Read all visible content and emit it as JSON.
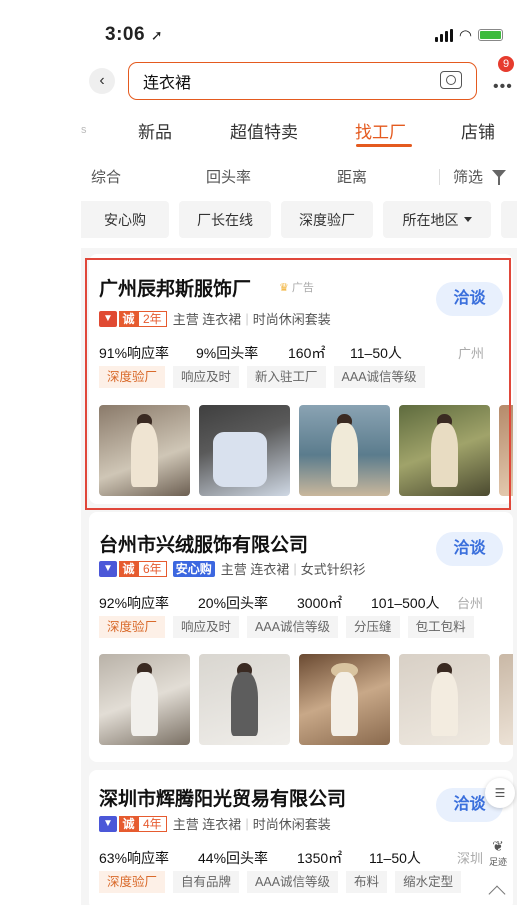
{
  "status_bar": {
    "time": "3:06",
    "location_icon": "location-arrow-icon"
  },
  "search": {
    "back_icon": "chevron-left-icon",
    "query": "连衣裙",
    "camera_icon": "camera-icon",
    "more_icon": "more-dots-icon",
    "badge_count": "9"
  },
  "tabs": [
    {
      "label": "新品",
      "active": false
    },
    {
      "label": "超值特卖",
      "active": false
    },
    {
      "label": "找工厂",
      "active": true
    },
    {
      "label": "店铺",
      "active": false
    }
  ],
  "tab_partial_left": "s",
  "sort_bar": {
    "items": [
      "综合",
      "回头率",
      "距离"
    ],
    "filter_label": "筛选",
    "filter_icon": "funnel-icon"
  },
  "chips": {
    "items": [
      "安心购",
      "厂长在线",
      "深度验厂"
    ],
    "region_label": "所在地区"
  },
  "colors": {
    "accent": "#e45a1f",
    "chat_bg": "#e8f0fd",
    "chat_text": "#3a6fdc",
    "highlight_border": "#e0473a"
  },
  "cards": [
    {
      "name": "广州辰邦斯服饰厂",
      "ad_label": "广告",
      "years": "2年",
      "cheng": "诚",
      "shield": "▼",
      "main_business": "主营 连衣裙",
      "categories": "时尚休闲套装",
      "chat": "洽谈",
      "stats": {
        "response": "91%响应率",
        "repeat": "9%回头率",
        "area": "160㎡",
        "staff": "11–50人",
        "city": "广州"
      },
      "tags": [
        {
          "text": "深度验厂",
          "style": "orange"
        },
        {
          "text": "响应及时",
          "style": "gray"
        },
        {
          "text": "新入驻工厂",
          "style": "gray"
        },
        {
          "text": "AAA诚信等级",
          "style": "gray"
        }
      ],
      "thumbs": [
        "dress-photo-cream",
        "dress-photo-blue-floral",
        "dress-photo-beach",
        "dress-photo-plaid"
      ]
    },
    {
      "name": "台州市兴绒服饰有限公司",
      "years": "6年",
      "cheng": "诚",
      "shield": "▼",
      "anxin": "安心购",
      "main_business": "主营 连衣裙",
      "categories": "女式针织衫",
      "chat": "洽谈",
      "stats": {
        "response": "92%响应率",
        "repeat": "20%回头率",
        "area": "3000㎡",
        "staff": "101–500人",
        "city": "台州"
      },
      "tags": [
        {
          "text": "深度验厂",
          "style": "orange"
        },
        {
          "text": "响应及时",
          "style": "gray"
        },
        {
          "text": "AAA诚信等级",
          "style": "gray"
        },
        {
          "text": "分压缝",
          "style": "gray"
        },
        {
          "text": "包工包料",
          "style": "gray"
        }
      ],
      "thumbs": [
        "dress-photo-street",
        "dress-photo-gray-pleated",
        "dress-photo-sunhat",
        "dress-photo-polka"
      ]
    },
    {
      "name": "深圳市辉腾阳光贸易有限公司",
      "years": "4年",
      "cheng": "诚",
      "shield": "▼",
      "main_business": "主营 连衣裙",
      "categories": "时尚休闲套装",
      "chat": "洽谈",
      "stats": {
        "response": "63%响应率",
        "repeat": "44%回头率",
        "area": "1350㎡",
        "staff": "11–50人",
        "city": "深圳"
      },
      "tags": [
        {
          "text": "深度验厂",
          "style": "orange"
        },
        {
          "text": "自有品牌",
          "style": "gray"
        },
        {
          "text": "AAA诚信等级",
          "style": "gray"
        },
        {
          "text": "布料",
          "style": "gray"
        },
        {
          "text": "缩水定型",
          "style": "gray"
        }
      ]
    }
  ],
  "floating": {
    "list_icon": "list-icon",
    "footprint_label": "足迹",
    "footprint_icon": "footprint-icon",
    "top_icon": "chevron-up-icon"
  }
}
